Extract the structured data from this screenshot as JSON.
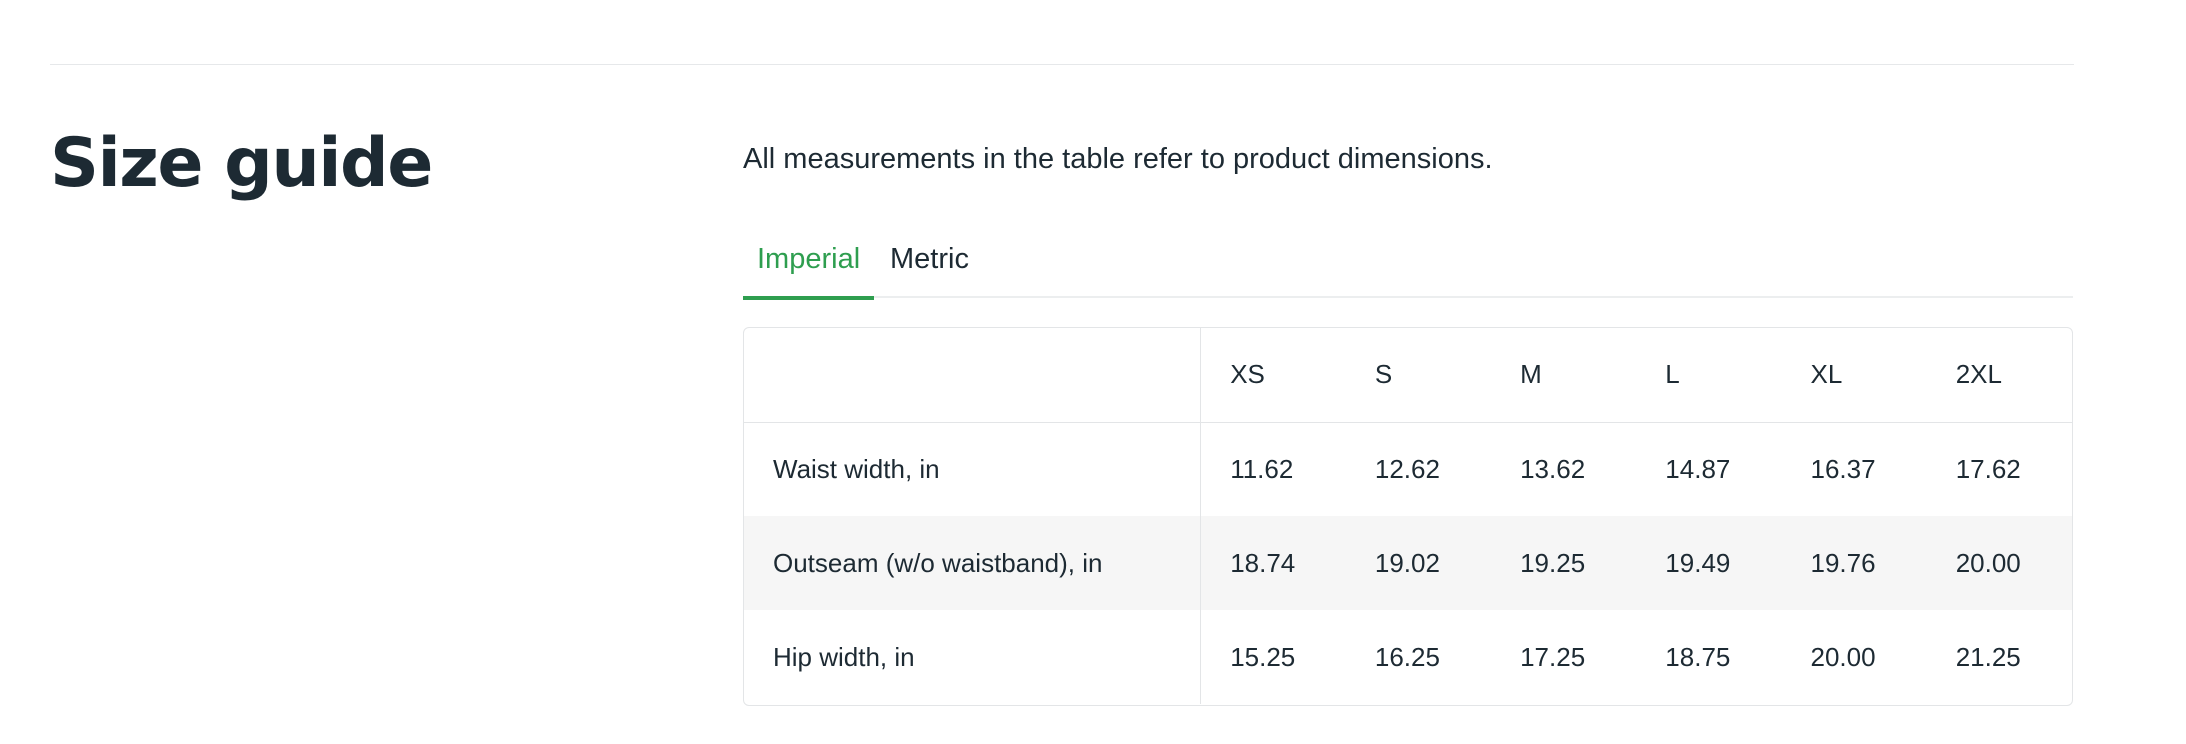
{
  "heading": {
    "title": "Size guide"
  },
  "intro": "All measurements in the table refer to product dimensions.",
  "tabs": [
    {
      "label": "Imperial",
      "active": true
    },
    {
      "label": "Metric",
      "active": false
    }
  ],
  "table": {
    "header": [
      "",
      "XS",
      "S",
      "M",
      "L",
      "XL",
      "2XL"
    ],
    "rows": [
      {
        "label": "Waist width, in",
        "values": [
          "11.62",
          "12.62",
          "13.62",
          "14.87",
          "16.37",
          "17.62"
        ]
      },
      {
        "label": "Outseam (w/o waistband), in",
        "values": [
          "18.74",
          "19.02",
          "19.25",
          "19.49",
          "19.76",
          "20.00"
        ]
      },
      {
        "label": "Hip width, in",
        "values": [
          "15.25",
          "16.25",
          "17.25",
          "18.75",
          "20.00",
          "21.25"
        ]
      }
    ]
  },
  "colors": {
    "accent": "#2e9e4f",
    "text": "#1d2a33",
    "row_shade": "#f6f6f6",
    "border": "#e3e5e7"
  }
}
